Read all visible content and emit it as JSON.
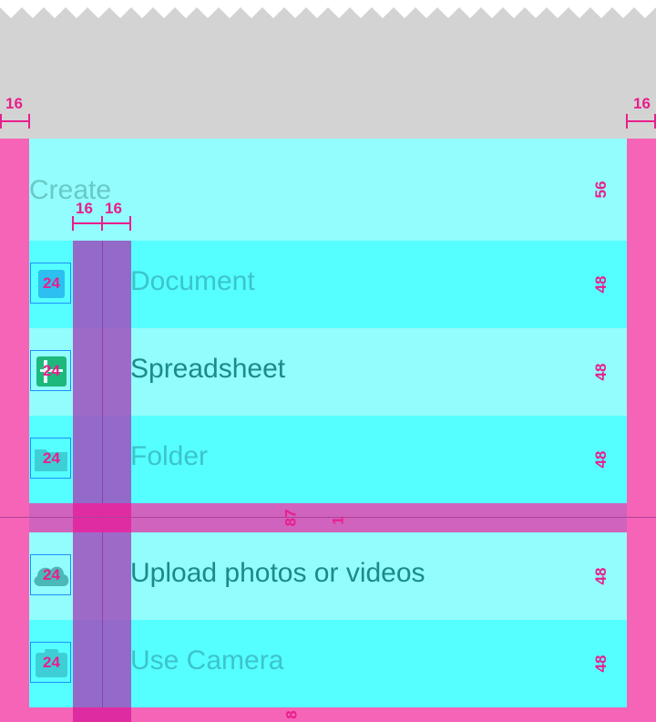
{
  "spec": {
    "margin_left": "16",
    "margin_right": "16",
    "icon_gap": "16",
    "text_gap": "16",
    "header_height": "56",
    "divider_space": "87",
    "divider_thickness": "1",
    "bottom_padding": "8",
    "icon_size": "24",
    "row_height": "48"
  },
  "menu": {
    "title": "Create",
    "items": [
      {
        "label": "Document",
        "icon": "document-icon"
      },
      {
        "label": "Spreadsheet",
        "icon": "spreadsheet-icon"
      },
      {
        "label": "Folder",
        "icon": "folder-icon"
      },
      {
        "label": "Upload photos or videos",
        "icon": "cloud-upload-icon"
      },
      {
        "label": "Use Camera",
        "icon": "camera-icon"
      }
    ]
  },
  "colors": {
    "sheet_light": "#93fcfc",
    "sheet_dark": "#55ffff",
    "spec_magenta": "#e91e8c",
    "padding_pink": "#f564b6",
    "background_gray": "#d3d3d3"
  }
}
